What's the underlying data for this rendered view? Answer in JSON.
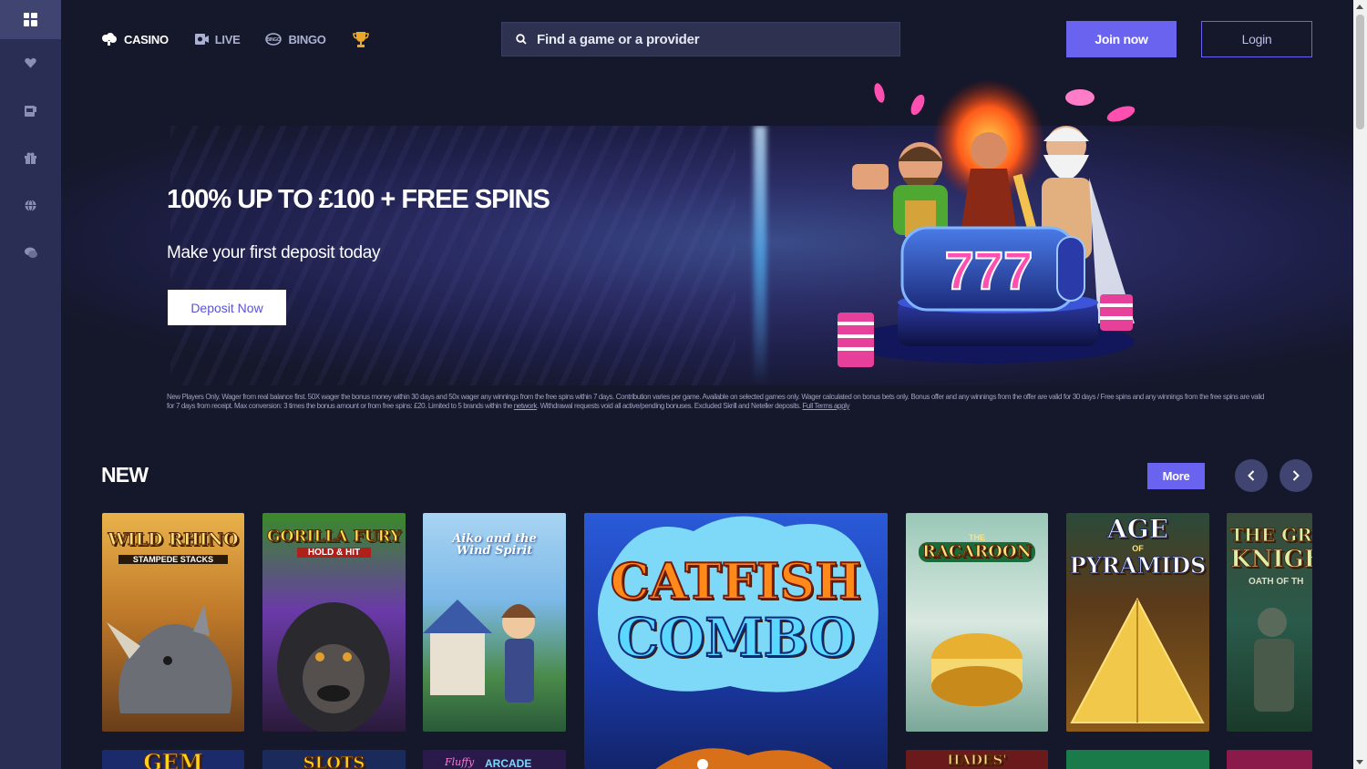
{
  "nav": {
    "links": [
      {
        "label": "CASINO",
        "active": true
      },
      {
        "label": "LIVE",
        "active": false
      },
      {
        "label": "BINGO",
        "active": false
      }
    ],
    "search_placeholder": "Find a game or a provider",
    "join_label": "Join now",
    "login_label": "Login"
  },
  "sidebar": {
    "items": [
      {
        "icon": "grid-icon",
        "active": true
      },
      {
        "icon": "heart-icon"
      },
      {
        "icon": "slot-machine-icon"
      },
      {
        "icon": "gift-icon"
      },
      {
        "icon": "globe-icon"
      },
      {
        "icon": "chat-icon"
      }
    ]
  },
  "banner": {
    "title": "100% UP TO £100 + FREE SPINS",
    "subtitle": "Make your first deposit today",
    "cta_label": "Deposit Now",
    "slot_digits": "777",
    "terms_text": "New Players Only. Wager from real balance first. 50X wager the bonus money within 30 days and 50x wager any winnings from the free spins within 7 days. Contribution varies per game. Available on selected games only. Wager calculated on bonus bets only. Bonus offer and any winnings from the offer are valid for 30 days / Free spins and any winnings from the free spins are valid for 7 days from receipt. Max conversion: 3 times the bonus amount or from free spins: £20. Limited to 5 brands within the ",
    "terms_network": "network",
    "terms_text_2": ". Withdrawal requests void all active/pending bonuses. Excluded Skrill and Neteller deposits. ",
    "terms_link": "Full Terms apply"
  },
  "section": {
    "title": "NEW",
    "more_label": "More"
  },
  "games": [
    {
      "title": "WILD RHINO",
      "subtitle": "STAMPEDE STACKS"
    },
    {
      "title": "GORILLA FURY",
      "subtitle": "HOLD & HIT"
    },
    {
      "title": "Aiko and the Wind Spirit",
      "subtitle": ""
    },
    {
      "title": "CATFISH",
      "title2": "COMBO"
    },
    {
      "title": "RACAROON",
      "subtitle": "THE"
    },
    {
      "title": "AGE",
      "title2": "PYRAMIDS",
      "subtitle": "OF"
    },
    {
      "title": "THE GRE",
      "title2": "KNIGH",
      "subtitle": "OATH OF TH"
    },
    {
      "title": "GEM"
    },
    {
      "title": "SLOTS"
    },
    {
      "title": "ARCADE",
      "subtitle": "Fluffy"
    },
    {
      "title": "HADES'"
    }
  ],
  "colors": {
    "accent": "#6a63f0",
    "background": "#15172a",
    "sidebar": "#2a2e55"
  }
}
